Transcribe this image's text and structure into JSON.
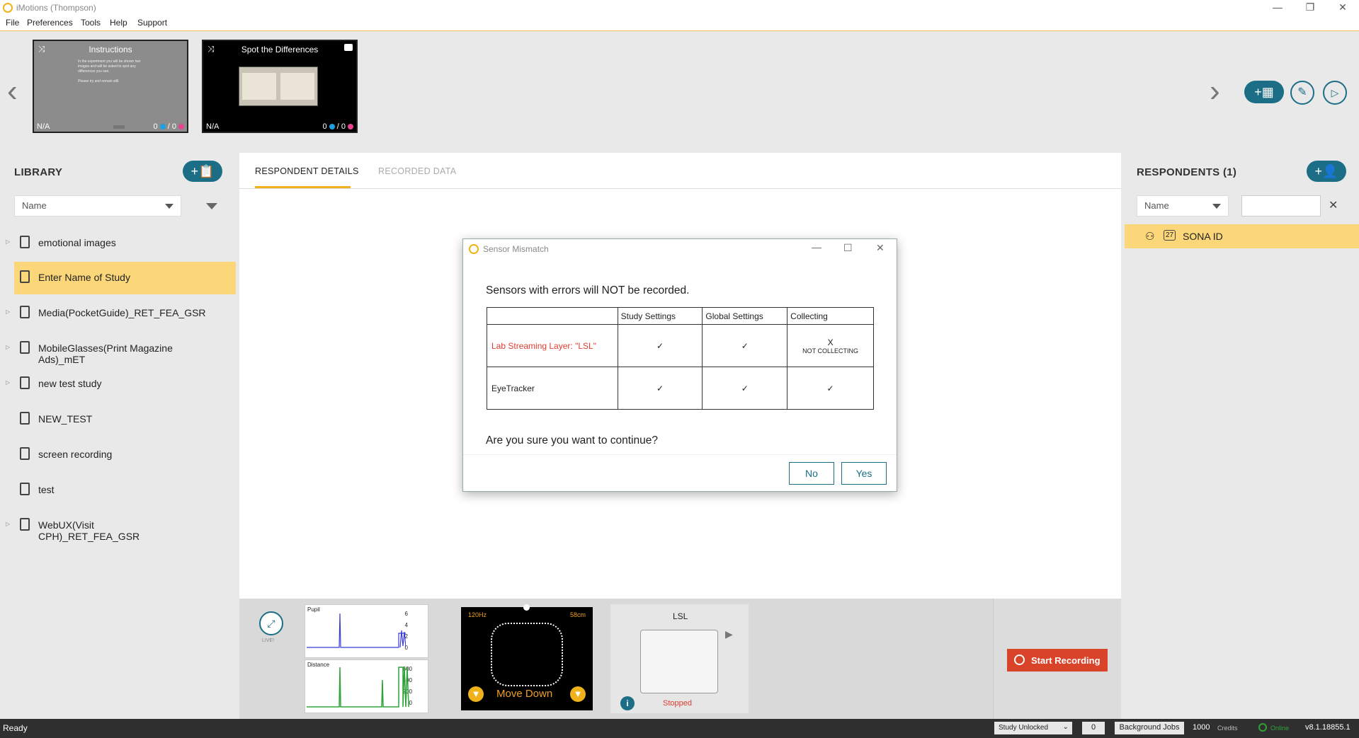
{
  "window": {
    "title": "iMotions (Thompson)",
    "minimize": "—",
    "restore": "❐",
    "close": "✕"
  },
  "menu": [
    "File",
    "Preferences",
    "Tools",
    "Help",
    "Support"
  ],
  "slides": [
    {
      "title": "Instructions",
      "na": "N/A",
      "count_a": "0",
      "sep": "/",
      "count_b": "0",
      "text_lines": [
        "In the experiment you will be shown two",
        "images and will be asked to spot any",
        "differences you see.",
        "",
        "Please try and remain still."
      ]
    },
    {
      "title": "Spot the Differences",
      "na": "N/A",
      "count_a": "0",
      "sep": "/",
      "count_b": "0"
    }
  ],
  "library": {
    "heading": "LIBRARY",
    "sort_select": "Name",
    "items": [
      {
        "label": "emotional images",
        "expandable": true
      },
      {
        "label": "Enter Name of Study",
        "expandable": false,
        "selected": true
      },
      {
        "label": "Media(PocketGuide)_RET_FEA_GSR",
        "expandable": true
      },
      {
        "label": "MobileGlasses(Print Magazine Ads)_mET",
        "expandable": true
      },
      {
        "label": "new test study",
        "expandable": true
      },
      {
        "label": "NEW_TEST",
        "expandable": false
      },
      {
        "label": "screen recording",
        "expandable": false
      },
      {
        "label": "test",
        "expandable": false
      },
      {
        "label": "WebUX(Visit CPH)_RET_FEA_GSR",
        "expandable": true
      }
    ]
  },
  "tabs": [
    {
      "label": "RESPONDENT DETAILS",
      "active": true
    },
    {
      "label": "RECORDED DATA",
      "active": false
    }
  ],
  "respondents": {
    "heading": "RESPONDENTS (1)",
    "sort_select": "Name",
    "search_value": "",
    "clear": "✕",
    "items": [
      {
        "badge": "27",
        "label": "SONA ID"
      }
    ]
  },
  "dialog": {
    "title": "Sensor Mismatch",
    "warning": "Sensors with errors will NOT be recorded.",
    "columns": [
      "",
      "Study Settings",
      "Global Settings",
      "Collecting"
    ],
    "rows": [
      {
        "name": "Lab Streaming Layer: \"LSL\"",
        "error": true,
        "study": "✓",
        "global": "✓",
        "collecting": "X",
        "collecting_note": "NOT COLLECTING"
      },
      {
        "name": "EyeTracker",
        "error": false,
        "study": "✓",
        "global": "✓",
        "collecting": "✓",
        "collecting_note": ""
      }
    ],
    "question": "Are you sure you want to continue?",
    "no": "No",
    "yes": "Yes"
  },
  "sensors": {
    "live_label": "LIVE!",
    "pupil_label": "Pupil",
    "pupil_ticks": [
      "6",
      "4",
      "2",
      "0"
    ],
    "distance_label": "Distance",
    "distance_ticks": [
      "600",
      "400",
      "200",
      "0"
    ],
    "eye_rate": "120Hz",
    "eye_distance": "58cm",
    "eye_message": "Move Down",
    "lsl_title": "LSL",
    "lsl_status": "Stopped",
    "start_recording": "Start Recording"
  },
  "statusbar": {
    "status": "Ready",
    "study_state": "Study Unlocked",
    "jobs_count": "0",
    "jobs_label": "Background Jobs",
    "credits_count": "1000",
    "credits_label": "Credits",
    "online": "Online",
    "version": "v8.1.18855.1"
  },
  "colors": {
    "accent": "#1b6e86",
    "highlight": "#fbd77a",
    "error": "#e03c31",
    "record": "#d9432a"
  }
}
